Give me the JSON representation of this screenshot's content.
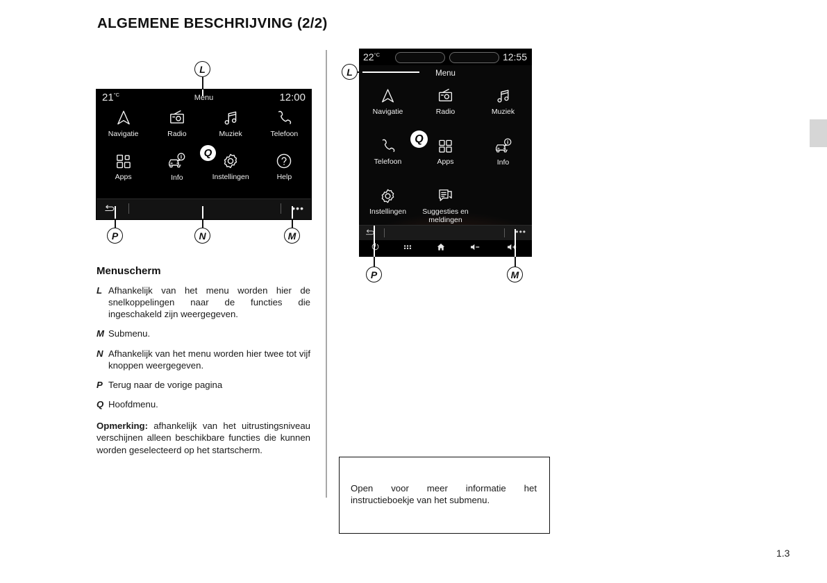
{
  "document": {
    "title": "ALGEMENE BESCHRIJVING (2/2)",
    "page_number": "1.3"
  },
  "screen_left": {
    "status": {
      "temperature": "21",
      "degree_symbol": "°C",
      "title": "Menu",
      "clock": "12:00"
    },
    "tiles": [
      {
        "label": "Navigatie",
        "icon": "navigation-arrow-icon"
      },
      {
        "label": "Radio",
        "icon": "radio-icon"
      },
      {
        "label": "Muziek",
        "icon": "music-note-icon"
      },
      {
        "label": "Telefoon",
        "icon": "phone-handset-icon"
      },
      {
        "label": "Apps",
        "icon": "apps-grid-icon"
      },
      {
        "label": "Info",
        "icon": "car-info-icon"
      },
      {
        "label": "Instellingen",
        "icon": "gear-icon"
      },
      {
        "label": "Help",
        "icon": "question-mark-icon"
      }
    ],
    "bottom_bar": {
      "back_icon": "back-arrow-icon",
      "more_icon": "ellipsis-icon"
    }
  },
  "screen_right": {
    "status": {
      "temperature": "22",
      "degree_symbol": "°C",
      "clock": "12:55"
    },
    "menu_title": "Menu",
    "tiles": [
      {
        "label": "Navigatie",
        "icon": "navigation-arrow-icon"
      },
      {
        "label": "Radio",
        "icon": "radio-icon"
      },
      {
        "label": "Muziek",
        "icon": "music-note-icon"
      },
      {
        "label": "Telefoon",
        "icon": "phone-handset-icon"
      },
      {
        "label": "Apps",
        "icon": "apps-grid-icon"
      },
      {
        "label": "Info",
        "icon": "car-info-icon"
      },
      {
        "label": "Instellingen",
        "icon": "gear-icon"
      },
      {
        "label": "Suggesties en meldingen",
        "icon": "suggestions-notifications-icon"
      }
    ],
    "bottom_bar": {
      "back_icon": "back-arrow-icon",
      "more_icon": "ellipsis-icon"
    },
    "hardware_bar": [
      {
        "icon": "power-icon"
      },
      {
        "icon": "apps-dots-icon"
      },
      {
        "icon": "home-icon"
      },
      {
        "icon": "volume-down-icon"
      },
      {
        "icon": "volume-up-icon"
      }
    ]
  },
  "callouts": {
    "left_top": "L",
    "left_q": "Q",
    "left_p": "P",
    "left_n": "N",
    "left_m": "M",
    "right_l": "L",
    "right_q": "Q",
    "right_p": "P",
    "right_m": "M"
  },
  "body": {
    "heading": "Menuscherm",
    "definitions": [
      {
        "key": "L",
        "text": "Afhankelijk van het menu worden hier de snelkoppelingen naar de functies die ingeschakeld zijn weergegeven."
      },
      {
        "key": "M",
        "text": "Submenu."
      },
      {
        "key": "N",
        "text": "Afhankelijk van het menu worden hier twee tot vijf knoppen weergegeven."
      },
      {
        "key": "P",
        "text": "Terug naar de vorige pagina"
      },
      {
        "key": "Q",
        "text": "Hoofdmenu."
      }
    ],
    "note_label": "Opmerking:",
    "note_text": " afhankelijk van het uitrustingsniveau verschijnen alleen beschikbare functies die kunnen worden geselecteerd op het startscherm."
  },
  "info_box": {
    "text": "Open voor meer informatie het instructieboekje van het submenu."
  }
}
